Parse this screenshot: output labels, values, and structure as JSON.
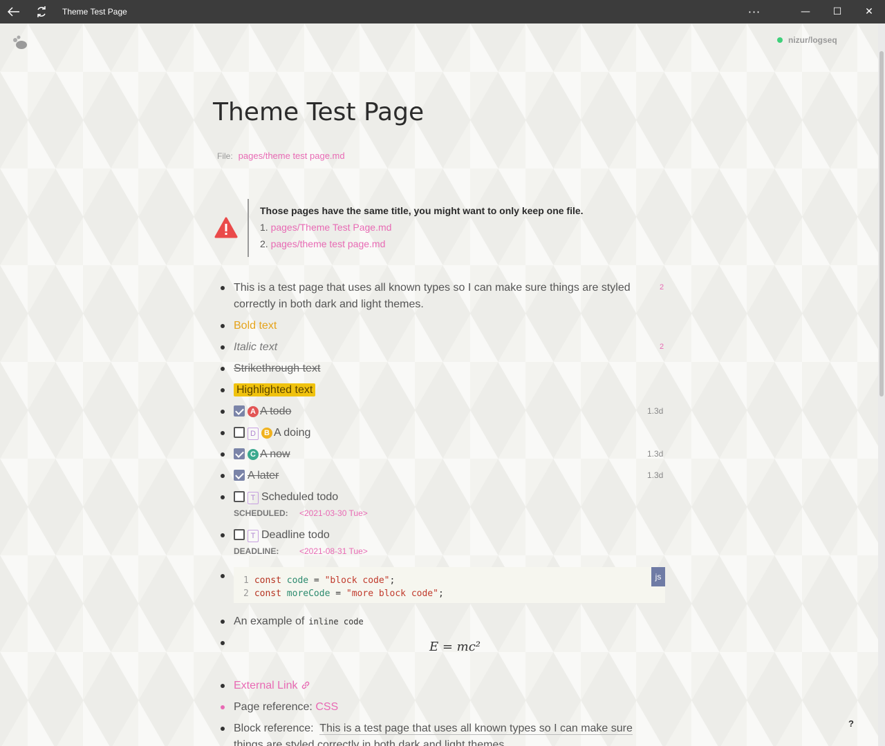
{
  "window": {
    "title": "Theme Test Page",
    "back_icon": "arrow-left-icon",
    "refresh_icon": "sync-icon",
    "more_label": "···",
    "minimize_label": "—",
    "maximize_label": "☐",
    "close_label": "✕"
  },
  "header": {
    "repo_name": "nizur/logseq",
    "repo_status_color": "#3ed07a"
  },
  "page": {
    "title": "Theme Test Page",
    "file_label": "File:",
    "file_path": "pages/theme test page.md"
  },
  "warning": {
    "title": "Those pages have the same title, you might want to only keep one file.",
    "files": [
      {
        "num": "1.",
        "path": "pages/Theme Test Page.md"
      },
      {
        "num": "2.",
        "path": "pages/theme test page.md"
      }
    ]
  },
  "blocks": {
    "intro": {
      "text": "This is a test page that uses all known types so I can make sure things are styled correctly in both dark and light themes.",
      "refs": "2"
    },
    "bold": "Bold text",
    "italic": {
      "text": "Italic text",
      "refs": "2"
    },
    "strike": "Strikethrough text",
    "highlight": "Highlighted text",
    "todo_a": {
      "priority": "A",
      "text": "A todo",
      "age": "1.3d"
    },
    "doing": {
      "marker": "D",
      "priority": "B",
      "text": "A doing"
    },
    "now": {
      "priority": "C",
      "text": "A now",
      "age": "1.3d"
    },
    "later": {
      "text": "A later",
      "age": "1.3d"
    },
    "scheduled": {
      "marker": "T",
      "text": "Scheduled todo",
      "key": "SCHEDULED:",
      "date": "<2021-03-30 Tue>"
    },
    "deadline": {
      "marker": "T",
      "text": "Deadline todo",
      "key": "DEADLINE:",
      "date": "<2021-08-31 Tue>"
    },
    "code": {
      "lang": "js",
      "lines": [
        {
          "num": "1",
          "kw": "const",
          "var": "code",
          "op": " = ",
          "str": "\"block code\"",
          "end": ";"
        },
        {
          "num": "2",
          "kw": "const",
          "var": "moreCode",
          "op": " = ",
          "str": "\"more block code\"",
          "end": ";"
        }
      ]
    },
    "inline_code": {
      "prefix": "An example of",
      "code": "inline code"
    },
    "math": "E = mc²",
    "external_link": "External Link",
    "page_ref": {
      "prefix": "Page reference:",
      "link": "CSS"
    },
    "block_ref": {
      "prefix": "Block reference:",
      "text": "This is a test page that uses all known types so I can make sure things are styled correctly in both dark and light themes."
    }
  },
  "help_label": "?"
}
